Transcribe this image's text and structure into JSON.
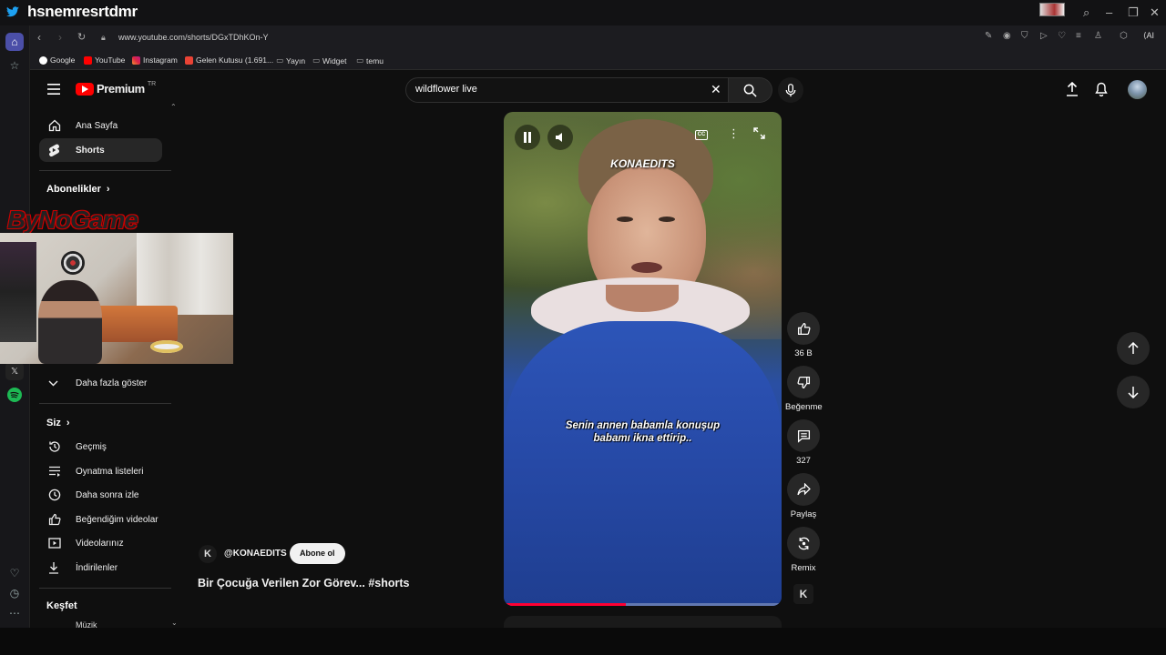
{
  "window": {
    "stream_overlay_name": "hsnemresrtdmr"
  },
  "browser": {
    "url": "www.youtube.com/shorts/DGxTDhKOn-Y",
    "bookmarks": [
      {
        "label": "Google",
        "icon": "google-icon",
        "color": "#4285f4"
      },
      {
        "label": "YouTube",
        "icon": "youtube-icon",
        "color": "#ff0000"
      },
      {
        "label": "Instagram",
        "icon": "instagram-icon",
        "color": "#e1306c"
      },
      {
        "label": "Gelen Kutusu (1.691...",
        "icon": "gmail-icon",
        "color": "#ea4335"
      },
      {
        "label": "Yayın",
        "icon": "folder-icon",
        "color": "#aaaaaa"
      },
      {
        "label": "Widget",
        "icon": "folder-icon",
        "color": "#aaaaaa"
      },
      {
        "label": "temu",
        "icon": "folder-icon",
        "color": "#aaaaaa"
      }
    ]
  },
  "youtube": {
    "logo_text": "Premium",
    "logo_region": "TR",
    "search_value": "wildflower live",
    "sidebar": {
      "main": [
        {
          "label": "Ana Sayfa",
          "icon": "home-icon"
        },
        {
          "label": "Shorts",
          "icon": "shorts-icon",
          "active": true
        }
      ],
      "subscriptions_heading": "Abonelikler",
      "show_more": "Daha fazla göster",
      "you_heading": "Siz",
      "you_items": [
        {
          "label": "Geçmiş",
          "icon": "history-icon"
        },
        {
          "label": "Oynatma listeleri",
          "icon": "playlist-icon"
        },
        {
          "label": "Daha sonra izle",
          "icon": "clock-icon"
        },
        {
          "label": "Beğendiğim videolar",
          "icon": "like-icon"
        },
        {
          "label": "Videolarınız",
          "icon": "video-icon"
        },
        {
          "label": "İndirilenler",
          "icon": "download-icon"
        }
      ],
      "explore_heading": "Keşfet",
      "partial_item": "Müzik"
    },
    "short": {
      "channel": "@KONAEDITS",
      "subscribe_label": "Abone ol",
      "title": "Bir Çocuğa Verilen Zor Görev... #shorts",
      "watermark": "KONAEDITS",
      "subtitle_line1": "Senin annen babamla konuşup",
      "subtitle_line2": "babamı ikna ettirip..",
      "progress": 0.44
    },
    "actions": [
      {
        "label": "36 B",
        "icon": "like-icon"
      },
      {
        "label": "Beğenme",
        "icon": "dislike-icon"
      },
      {
        "label": "327",
        "icon": "comment-icon"
      },
      {
        "label": "Paylaş",
        "icon": "share-icon"
      },
      {
        "label": "Remix",
        "icon": "remix-icon"
      }
    ]
  },
  "overlay": {
    "cam_logo": "ByNoGame"
  }
}
